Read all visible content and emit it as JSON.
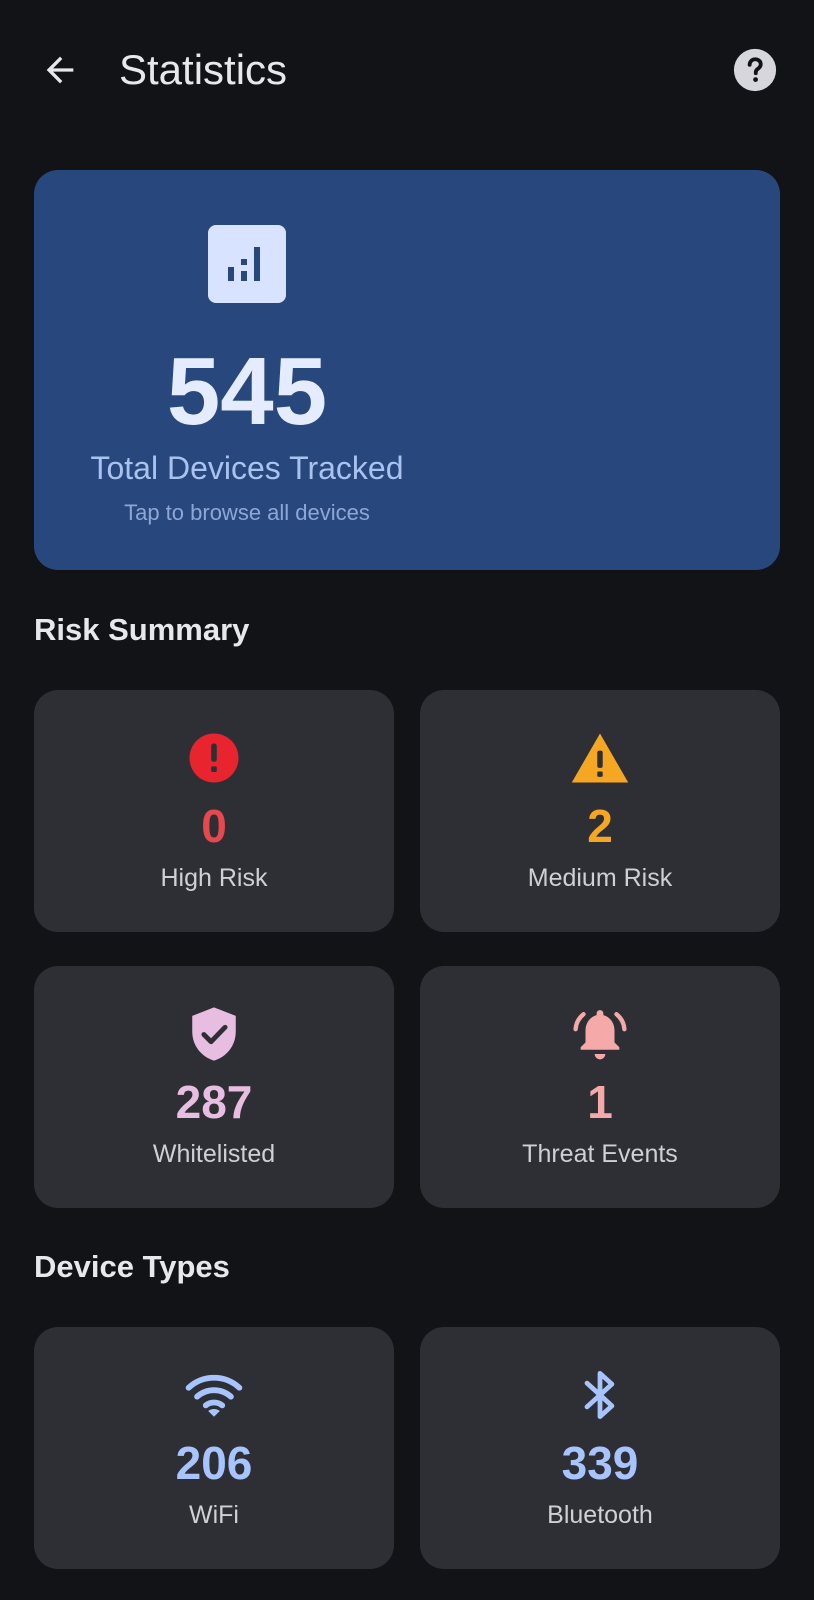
{
  "header": {
    "title": "Statistics",
    "back_icon": "arrow-back-icon",
    "help_icon": "help-icon"
  },
  "hero": {
    "icon": "bar-chart-icon",
    "total": "545",
    "label": "Total Devices Tracked",
    "hint": "Tap to browse all devices"
  },
  "risk_summary": {
    "title": "Risk Summary",
    "items": [
      {
        "value": "0",
        "label": "High Risk",
        "icon": "error-icon",
        "color": "#e5484d"
      },
      {
        "value": "2",
        "label": "Medium Risk",
        "icon": "warning-icon",
        "color": "#f5a623"
      },
      {
        "value": "287",
        "label": "Whitelisted",
        "icon": "shield-check-icon",
        "color": "#e7bde2"
      },
      {
        "value": "1",
        "label": "Threat Events",
        "icon": "alarm-bell-icon",
        "color": "#f6a9a9"
      }
    ]
  },
  "device_types": {
    "title": "Device Types",
    "items": [
      {
        "value": "206",
        "label": "WiFi",
        "icon": "wifi-icon",
        "color": "#a8c4ff"
      },
      {
        "value": "339",
        "label": "Bluetooth",
        "icon": "bluetooth-icon",
        "color": "#a8c4ff"
      }
    ]
  },
  "colors": {
    "background": "#121317",
    "hero_card": "#28487d",
    "tile": "#2e2f34"
  }
}
